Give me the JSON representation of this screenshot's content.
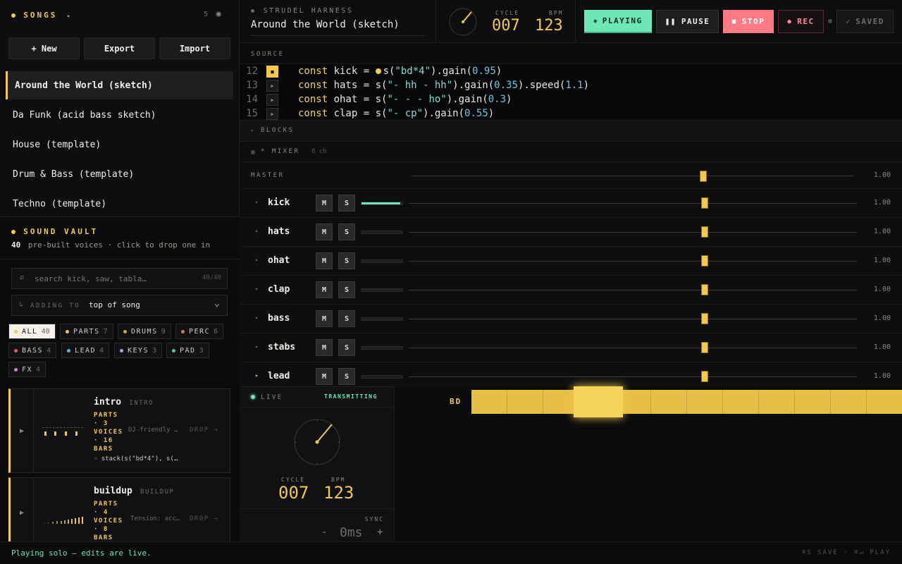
{
  "songs": {
    "title": "SONGS",
    "count": "5",
    "buttons": {
      "new": "+ New",
      "export": "Export",
      "import": "Import"
    },
    "items": [
      "Around the World (sketch)",
      "Da Funk (acid bass sketch)",
      "House (template)",
      "Drum & Bass (template)",
      "Techno (template)"
    ]
  },
  "vault": {
    "title": "SOUND VAULT",
    "count": "40",
    "subtitle": "pre-built voices · click to drop one in",
    "search_placeholder": "search kick, saw, tabla…",
    "search_count": "40/40",
    "adding_label": "ADDING TO",
    "adding_value": "top of song",
    "chips": [
      {
        "label": "ALL",
        "n": "40",
        "color": "#f2c94c"
      },
      {
        "label": "PARTS",
        "n": "7",
        "color": "#f2c94c"
      },
      {
        "label": "DRUMS",
        "n": "9",
        "color": "#d9a441"
      },
      {
        "label": "PERC",
        "n": "6",
        "color": "#e07a3a"
      },
      {
        "label": "BASS",
        "n": "4",
        "color": "#e05a6a"
      },
      {
        "label": "LEAD",
        "n": "4",
        "color": "#5ab8e0"
      },
      {
        "label": "KEYS",
        "n": "3",
        "color": "#b8a0e0"
      },
      {
        "label": "PAD",
        "n": "3",
        "color": "#5ac8a0"
      },
      {
        "label": "FX",
        "n": "4",
        "color": "#d080d0"
      }
    ],
    "cards": [
      {
        "name": "intro",
        "tag": "INTRO",
        "meta": "PARTS · 3 VOICES · 16 BARS",
        "desc": "DJ-friendly …",
        "drop": "DROP →",
        "code": "stack(s(\"bd*4\"), s(…"
      },
      {
        "name": "buildup",
        "tag": "BUILDUP",
        "meta": "PARTS · 4 VOICES · 8 BARS",
        "desc": "Tension: acc…",
        "drop": "DROP →"
      }
    ]
  },
  "header": {
    "app": "STRUDEL HARNESS",
    "song_title": "Around the World (sketch)",
    "cycle_label": "CYCLE",
    "cycle": "007",
    "bpm_label": "BPM",
    "bpm": "123",
    "playing": "PLAYING",
    "pause": "PAUSE",
    "stop": "STOP",
    "rec": "REC",
    "saved": "SAVED"
  },
  "source": {
    "label": "SOURCE",
    "lines": [
      {
        "n": "12",
        "parts": [
          [
            "kw",
            "const "
          ],
          [
            "fn",
            "kick = "
          ],
          [
            "fn",
            "s("
          ],
          [
            "str",
            "\"bd*4\""
          ],
          [
            "fn",
            ").gain("
          ],
          [
            "num",
            "0.95"
          ],
          [
            "fn",
            ")"
          ]
        ]
      },
      {
        "n": "13",
        "parts": [
          [
            "kw",
            "const "
          ],
          [
            "fn",
            "hats = s("
          ],
          [
            "str",
            "\"- hh - hh\""
          ],
          [
            "fn",
            ").gain("
          ],
          [
            "num",
            "0.35"
          ],
          [
            "fn",
            ").speed("
          ],
          [
            "num",
            "1.1"
          ],
          [
            "fn",
            ")"
          ]
        ]
      },
      {
        "n": "14",
        "parts": [
          [
            "kw",
            "const "
          ],
          [
            "fn",
            "ohat = s("
          ],
          [
            "str",
            "\"- - - ho\""
          ],
          [
            "fn",
            ").gain("
          ],
          [
            "num",
            "0.3"
          ],
          [
            "fn",
            ")"
          ]
        ]
      },
      {
        "n": "15",
        "parts": [
          [
            "kw",
            "const "
          ],
          [
            "fn",
            "clap = s("
          ],
          [
            "str",
            "\"- cp\""
          ],
          [
            "fn",
            ").gain("
          ],
          [
            "num",
            "0.55"
          ],
          [
            "fn",
            ")"
          ]
        ]
      }
    ]
  },
  "blocks": {
    "label": "BLOCKS"
  },
  "mixer": {
    "label": "* MIXER",
    "channels_count": "8 ch",
    "master_label": "MASTER",
    "master_value": "1.00",
    "master_level": 0.66,
    "channels": [
      {
        "name": "kick",
        "value": "1.00",
        "level": 0.66,
        "meter": 0.95
      },
      {
        "name": "hats",
        "value": "1.00",
        "level": 0.66,
        "meter": 0
      },
      {
        "name": "ohat",
        "value": "1.00",
        "level": 0.66,
        "meter": 0
      },
      {
        "name": "clap",
        "value": "1.00",
        "level": 0.66,
        "meter": 0
      },
      {
        "name": "bass",
        "value": "1.00",
        "level": 0.66,
        "meter": 0
      },
      {
        "name": "stabs",
        "value": "1.00",
        "level": 0.66,
        "meter": 0
      },
      {
        "name": "lead",
        "value": "1.00",
        "level": 0.66,
        "meter": 0
      }
    ],
    "mute": "M",
    "solo": "S"
  },
  "live": {
    "label": "LIVE",
    "status": "TRANSMITTING",
    "cycle_label": "CYCLE",
    "cycle": "007",
    "bpm_label": "BPM",
    "bpm": "123",
    "sync_label": "SYNC",
    "sync_value": "0ms",
    "minus": "-",
    "plus": "+",
    "track_label": "BD"
  },
  "footer": {
    "status": "Playing solo — edits are live.",
    "hint": "⌘S SAVE · ⌘↵ PLAY"
  },
  "colors": {
    "accent": "#f2c94c",
    "green": "#6ee7b7",
    "red": "#ff7a85"
  }
}
